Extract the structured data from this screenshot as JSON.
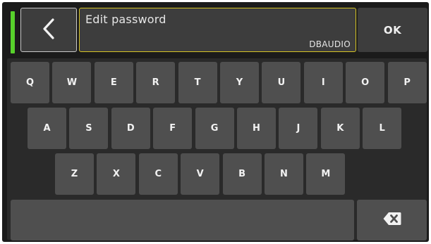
{
  "header": {
    "title": "Edit password",
    "value": "DBAUDIO",
    "ok_label": "OK",
    "status_color": "#57d12b",
    "field_border_color": "#d6c424"
  },
  "keyboard": {
    "rows": [
      [
        "Q",
        "W",
        "E",
        "R",
        "T",
        "Y",
        "U",
        "I",
        "O",
        "P"
      ],
      [
        "A",
        "S",
        "D",
        "F",
        "G",
        "H",
        "J",
        "K",
        "L"
      ],
      [
        "Z",
        "X",
        "C",
        "V",
        "B",
        "N",
        "M"
      ]
    ],
    "space_icon": "space-bar",
    "backspace_icon": "backspace-icon"
  }
}
